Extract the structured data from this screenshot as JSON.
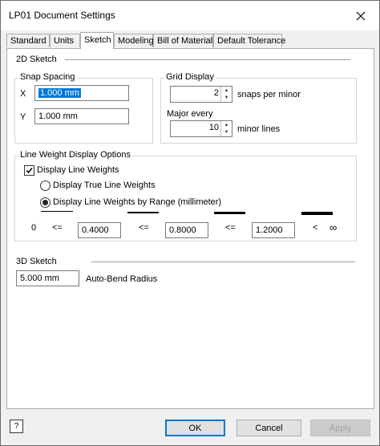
{
  "window": {
    "title": "LP01 Document Settings"
  },
  "tabs": [
    "Standard",
    "Units",
    "Sketch",
    "Modeling",
    "Bill of Materials",
    "Default Tolerance"
  ],
  "sketch2d": {
    "heading": "2D Sketch",
    "snap": {
      "title": "Snap Spacing",
      "x_label": "X",
      "x_value": "1.000 mm",
      "y_label": "Y",
      "y_value": "1.000 mm"
    },
    "grid": {
      "title": "Grid Display",
      "snaps_value": "2",
      "snaps_label": "snaps per minor",
      "major_label": "Major every",
      "minor_value": "10",
      "minor_label": "minor lines"
    }
  },
  "lineweight": {
    "title": "Line Weight Display Options",
    "display_label": "Display Line Weights",
    "true_label": "Display True Line Weights",
    "range_label": "Display Line Weights by Range (millimeter)",
    "zero": "0",
    "le": "<=",
    "lt": "<",
    "inf": "∞",
    "values": [
      "0.4000",
      "0.8000",
      "1.2000"
    ]
  },
  "sketch3d": {
    "heading": "3D Sketch",
    "radius_value": "5.000 mm",
    "radius_label": "Auto-Bend Radius"
  },
  "buttons": {
    "ok": "OK",
    "cancel": "Cancel",
    "apply": "Apply",
    "help": "?"
  }
}
